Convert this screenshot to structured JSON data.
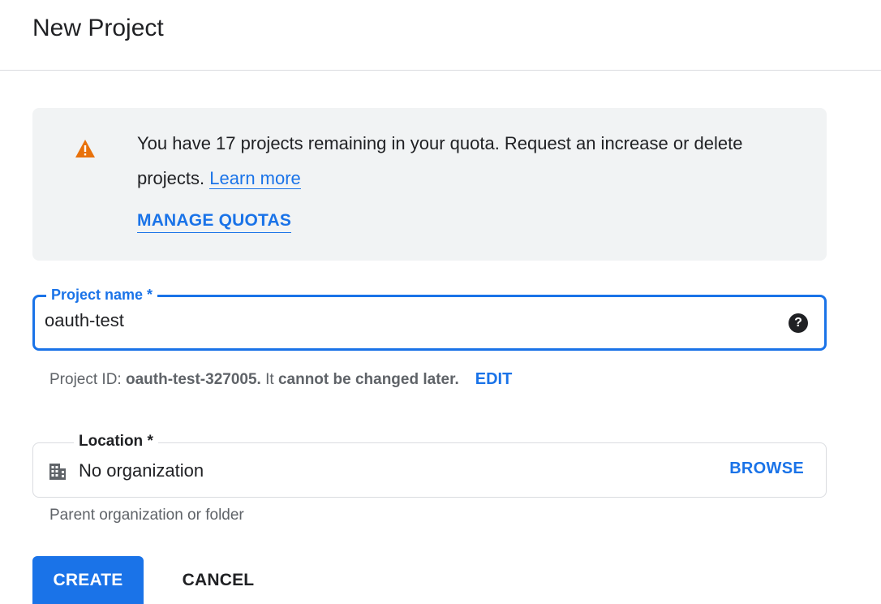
{
  "header": {
    "title": "New Project"
  },
  "quota_alert": {
    "icon": "warning-icon",
    "icon_color": "#e8710a",
    "message": "You have 17 projects remaining in your quota. Request an increase or delete projects.",
    "learn_more_label": "Learn more",
    "manage_quotas_label": "MANAGE QUOTAS"
  },
  "project_name_field": {
    "label": "Project name *",
    "value": "oauth-test",
    "help_icon": "help-icon"
  },
  "project_id_info": {
    "prefix": "Project ID: ",
    "project_id": "oauth-test-327005.",
    "middle": " It ",
    "suffix": "cannot be changed later.",
    "edit_label": "EDIT"
  },
  "location_field": {
    "label": "Location *",
    "icon": "building-icon",
    "value": "No organization",
    "browse_label": "BROWSE",
    "helper_text": "Parent organization or folder"
  },
  "actions": {
    "create_label": "CREATE",
    "cancel_label": "CANCEL"
  },
  "colors": {
    "accent": "#1a73e8",
    "warning": "#e8710a",
    "alert_background": "#f1f3f4"
  }
}
